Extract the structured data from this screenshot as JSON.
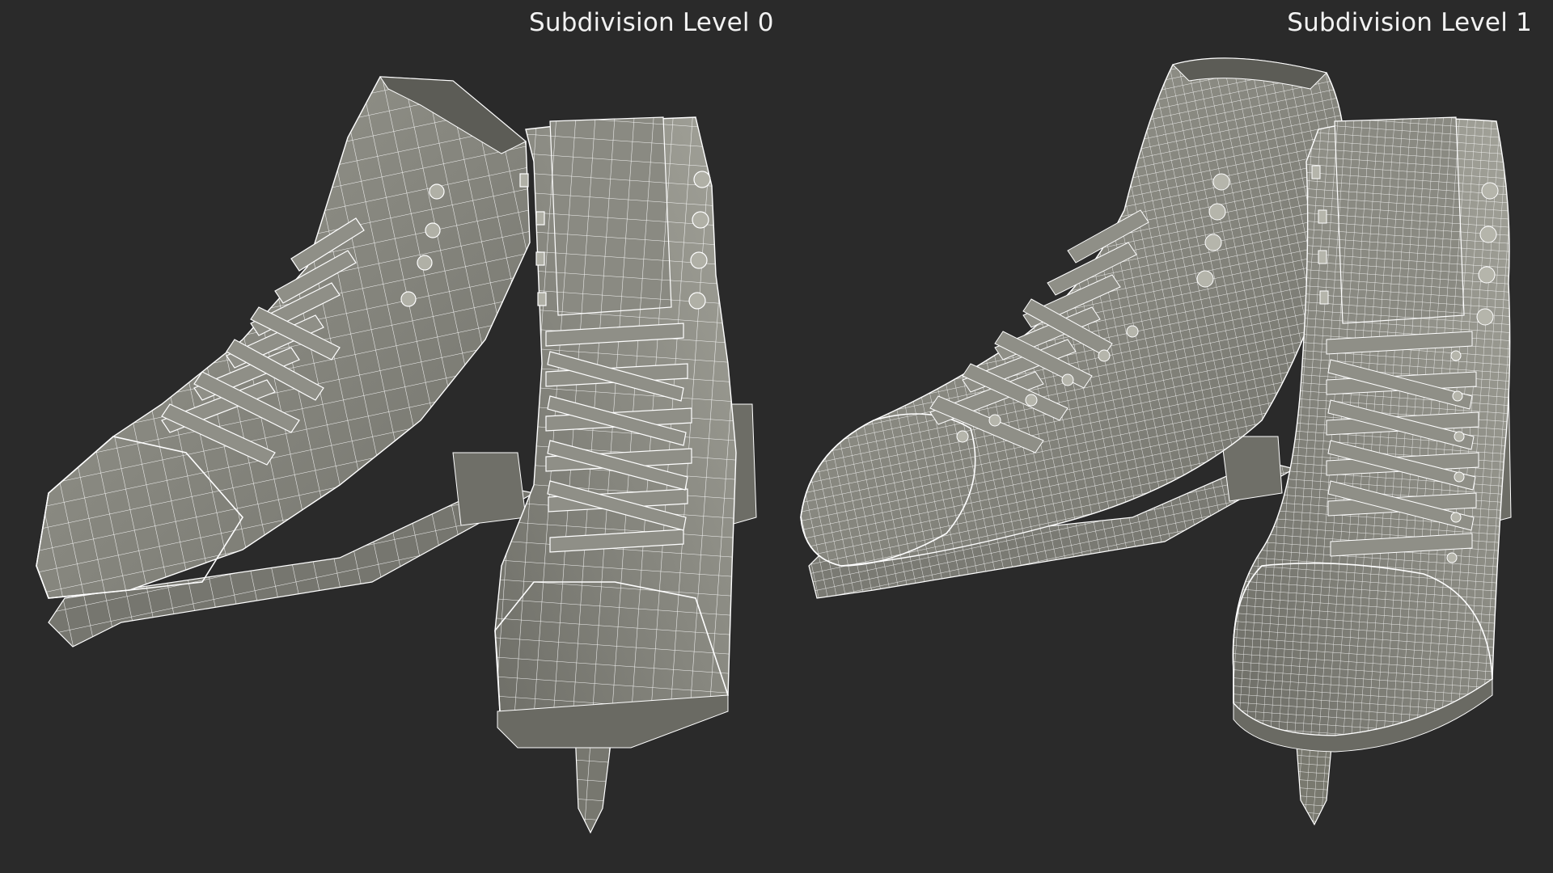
{
  "render": {
    "background_color": "#2a2a2a",
    "mesh_fill_color": "#8a8a82",
    "wire_color": "#ffffff",
    "views": [
      {
        "label": "Subdivision Level 0",
        "subject": "ice-skates-pair-wireframe",
        "wire_density": "low"
      },
      {
        "label": "Subdivision Level 1",
        "subject": "ice-skates-pair-wireframe",
        "wire_density": "high"
      }
    ]
  }
}
